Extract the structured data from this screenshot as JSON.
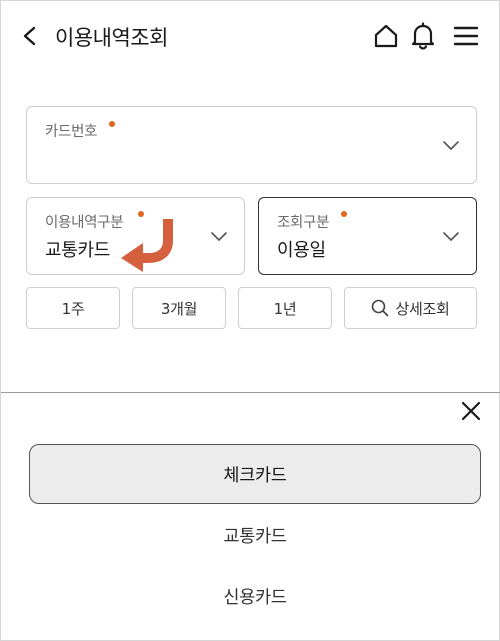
{
  "header": {
    "title": "이용내역조회",
    "icons": [
      "back-icon",
      "home-icon",
      "bell-icon",
      "menu-icon"
    ]
  },
  "form": {
    "card_number": {
      "label": "카드번호",
      "value": ""
    },
    "usage_type": {
      "label": "이용내역구분",
      "value": "교통카드"
    },
    "query_type": {
      "label": "조회구분",
      "value": "이용일"
    },
    "required_color": "#e0661f"
  },
  "period_buttons": {
    "week": "1주",
    "three_months": "3개월",
    "year": "1년",
    "detail": "상세조회"
  },
  "sheet": {
    "options": [
      "체크카드",
      "교통카드",
      "신용카드"
    ],
    "selected_index": 0
  },
  "accent_arrow_color": "#d5603d"
}
